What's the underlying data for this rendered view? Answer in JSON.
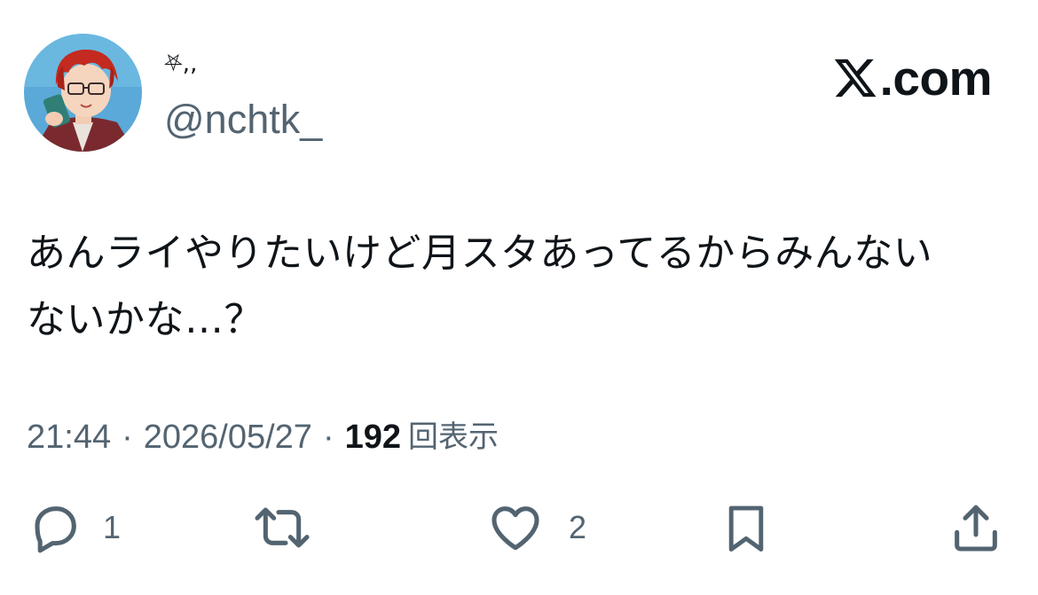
{
  "post": {
    "display_name": "⛧,,",
    "handle": "@nchtk_",
    "text_line1": "あんライやりたいけど月スタあってるからみんない",
    "text_line2": "ないかな…？",
    "time": "21:44",
    "separator": "·",
    "date": "2026/05/27",
    "views_count": "192",
    "views_label": "回表示"
  },
  "brand": {
    "suffix": ".com"
  },
  "actions": {
    "reply_count": "1",
    "like_count": "2"
  },
  "icons": {
    "avatar": "avatar",
    "brand": "x-logo-icon",
    "reply": "reply-icon",
    "repost": "repost-icon",
    "like": "heart-icon",
    "bookmark": "bookmark-icon",
    "share": "share-icon"
  },
  "colors": {
    "text_primary": "#0f1419",
    "text_secondary": "#536471",
    "background": "#ffffff"
  }
}
